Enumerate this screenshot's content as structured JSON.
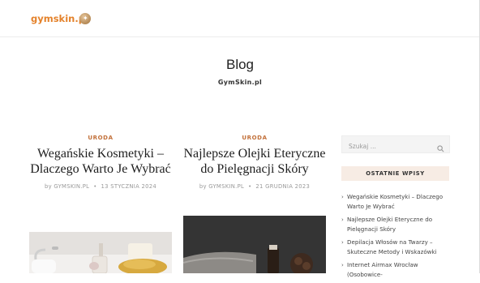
{
  "header": {
    "logo_text": "gymskin.pl",
    "logo_color": "#e4822b"
  },
  "page": {
    "title": "Blog",
    "subtitle": "GymSkin.pl"
  },
  "posts": [
    {
      "category": "URODA",
      "title": "Wegańskie Kosmetyki – Dlaczego Warto Je Wybrać",
      "author": "by GYMSKIN.PL",
      "date": "13 STYCZNIA 2024"
    },
    {
      "category": "URODA",
      "title": "Najlepsze Olejki Eteryczne do Pielęgnacji Skóry",
      "author": "by GYMSKIN.PL",
      "date": "21 GRUDNIA 2023"
    }
  ],
  "sidebar": {
    "search_placeholder": "Szukaj ...",
    "recent_heading": "OSTATNIE WPISY",
    "recent_posts": [
      "Wegańskie Kosmetyki – Dlaczego Warto Je Wybrać",
      "Najlepsze Olejki Eteryczne do Pielęgnacji Skóry",
      "Depilacja Włosów na Twarzy – Skuteczne Metody i Wskazówki",
      "Internet Airmax Wrocław (Osobowice-"
    ]
  },
  "colors": {
    "accent": "#c2703a",
    "widget_bg": "#f7ece4"
  }
}
